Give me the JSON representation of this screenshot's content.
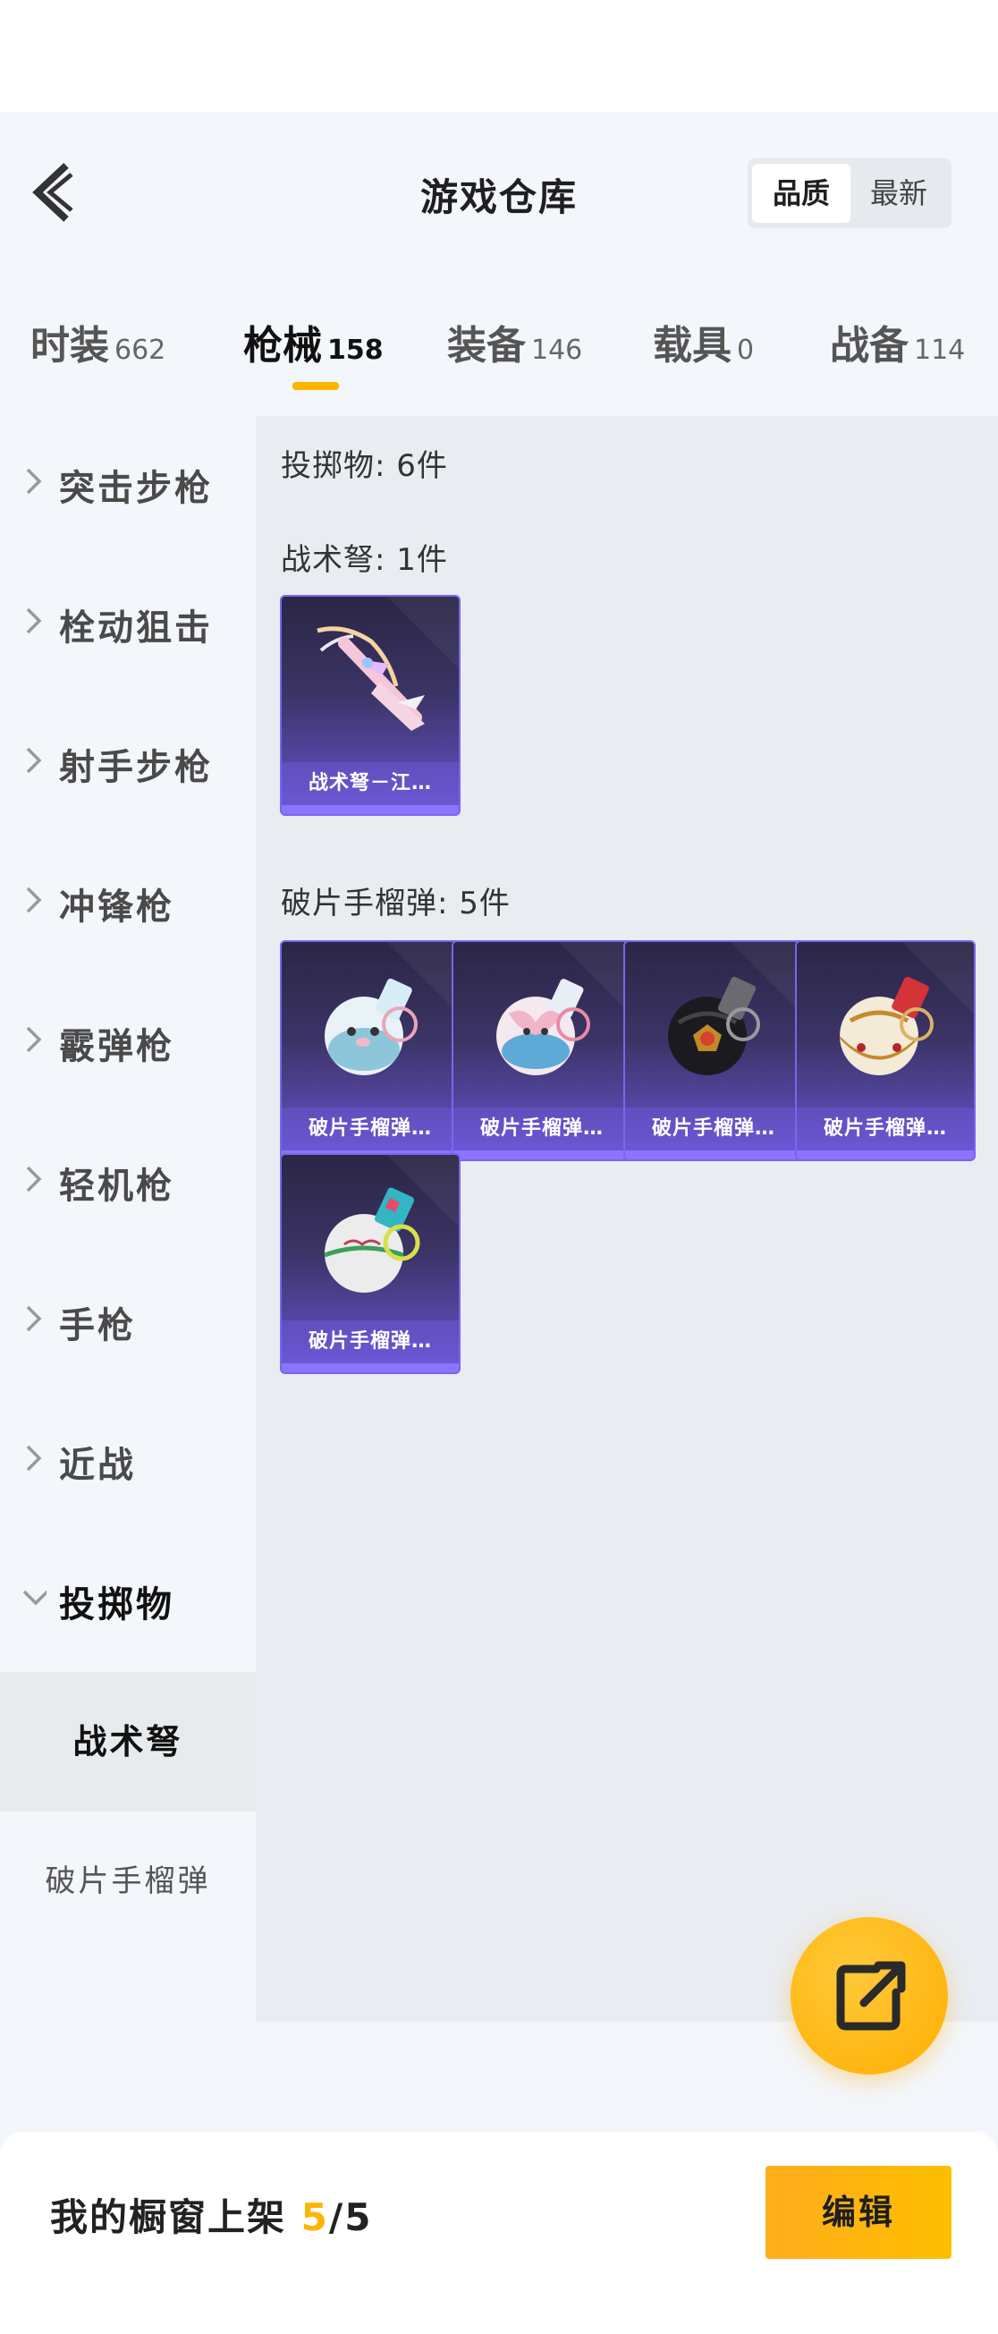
{
  "header": {
    "title": "游戏仓库",
    "sort_options": [
      "品质",
      "最新"
    ],
    "sort_selected": "品质"
  },
  "tabs": [
    {
      "label": "时装",
      "count": "662",
      "active": false
    },
    {
      "label": "枪械",
      "count": "158",
      "active": true
    },
    {
      "label": "装备",
      "count": "146",
      "active": false
    },
    {
      "label": "载具",
      "count": "0",
      "active": false
    },
    {
      "label": "战备",
      "count": "114",
      "active": false
    }
  ],
  "sidebar": {
    "categories": [
      {
        "label": "突击步枪",
        "expanded": false
      },
      {
        "label": "栓动狙击",
        "expanded": false
      },
      {
        "label": "射手步枪",
        "expanded": false
      },
      {
        "label": "冲锋枪",
        "expanded": false
      },
      {
        "label": "霰弹枪",
        "expanded": false
      },
      {
        "label": "轻机枪",
        "expanded": false
      },
      {
        "label": "手枪",
        "expanded": false
      },
      {
        "label": "近战",
        "expanded": false
      },
      {
        "label": "投掷物",
        "expanded": true
      }
    ],
    "subcategories": [
      {
        "label": "战术弩",
        "selected": true
      },
      {
        "label": "破片手榴弹",
        "selected": false
      }
    ]
  },
  "content": {
    "summary": "投掷物: 6件",
    "sections": [
      {
        "title": "战术弩: 1件",
        "items": [
          {
            "name": "战术弩－江…",
            "icon": "pink-crossbow-icon"
          }
        ]
      },
      {
        "title": "破片手榴弹: 5件",
        "items": [
          {
            "name": "破片手榴弹…",
            "icon": "blue-seal-grenade-icon"
          },
          {
            "name": "破片手榴弹…",
            "icon": "pink-fox-grenade-icon"
          },
          {
            "name": "破片手榴弹…",
            "icon": "black-gold-grenade-icon"
          },
          {
            "name": "破片手榴弹…",
            "icon": "gold-white-grenade-icon"
          },
          {
            "name": "破片手榴弹…",
            "icon": "white-graffiti-grenade-icon"
          }
        ]
      }
    ]
  },
  "footer": {
    "label": "我的橱窗上架",
    "current": "5",
    "total": "/5",
    "edit_label": "编辑"
  },
  "colors": {
    "accent": "#ffb400",
    "card_purple": "#6b57d6",
    "background": "#f3f6fa"
  }
}
